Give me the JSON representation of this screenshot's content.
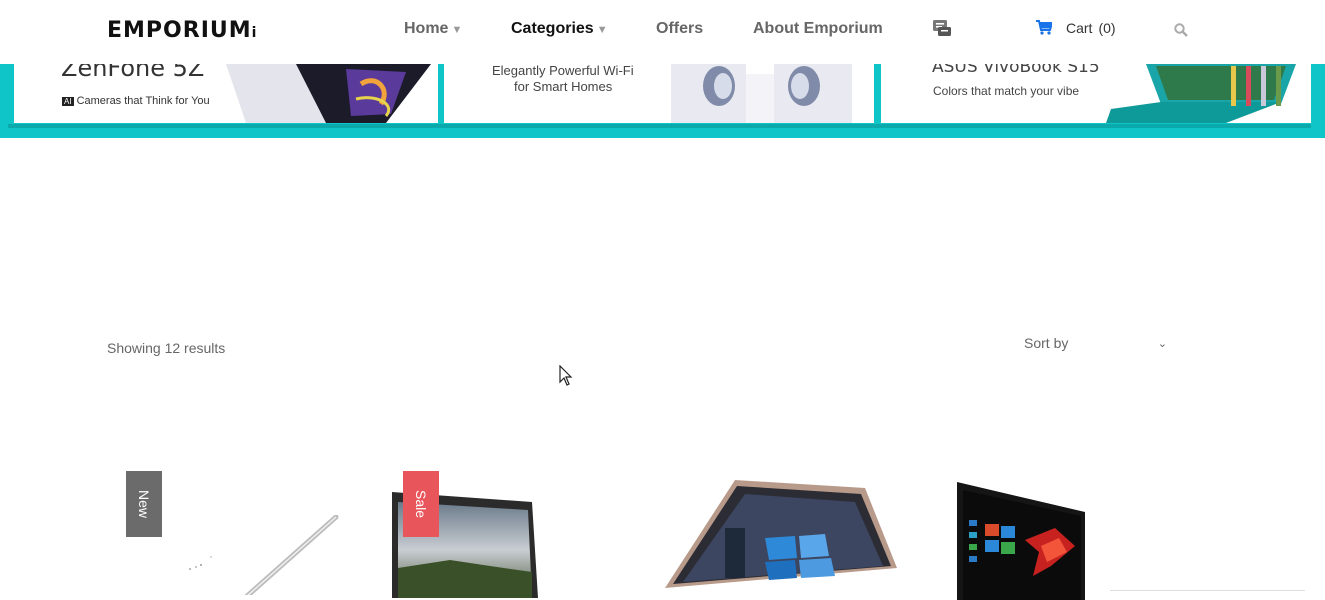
{
  "brand": {
    "logo_text": "EMPORIUM",
    "logo_suffix": "i"
  },
  "nav": {
    "home": "Home",
    "categories": "Categories",
    "offers": "Offers",
    "about": "About Emporium",
    "cart_label": "Cart",
    "cart_count": "(0)"
  },
  "banner": {
    "panel1": {
      "title": "ZenFone 5Z",
      "subtitle": "Cameras that Think for You",
      "subtitle_badge": "AI"
    },
    "panel2": {
      "title_line1": "Elegantly Powerful Wi-Fi",
      "title_line2": "for Smart Homes"
    },
    "panel3": {
      "title": "ASUS VivoBook S15",
      "subtitle": "Colors that match your vibe"
    }
  },
  "listing": {
    "results_text": "Showing 12 results",
    "sort_label": "Sort by"
  },
  "products": [
    {
      "badge": "New",
      "badge_color": "#6b6b6b"
    },
    {
      "badge": "Sale",
      "badge_color": "#e8555a"
    },
    {
      "badge": ""
    },
    {
      "badge": ""
    }
  ],
  "colors": {
    "accent": "#10c5c8",
    "cart_blue": "#1a73e8",
    "sale": "#e8555a"
  }
}
